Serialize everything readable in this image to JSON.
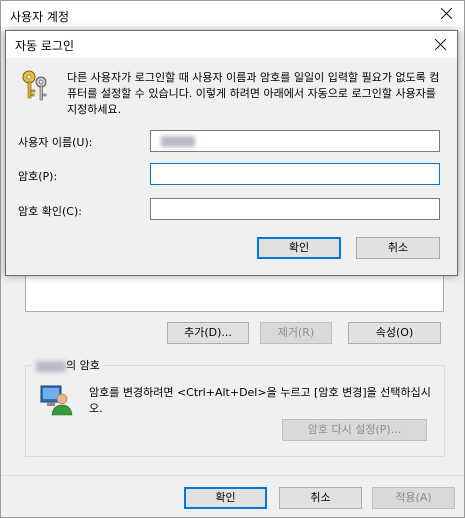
{
  "parent": {
    "title": "사용자 계정",
    "buttons": {
      "add": "추가(D)...",
      "remove": "제거(R)",
      "properties": "속성(O)"
    },
    "password_group": {
      "legend_suffix": "의 암호",
      "text": "암호를 변경하려면 <Ctrl+Alt+Del>을 누르고 [암호 변경]을 선택하십시오.",
      "reset_button": "암호 다시 설정(P)..."
    },
    "footer": {
      "ok": "확인",
      "cancel": "취소",
      "apply": "적용(A)"
    },
    "icons": {
      "close": "close-icon",
      "user": "user-at-computer-icon"
    }
  },
  "dialog": {
    "title": "자동 로그인",
    "description": "다른 사용자가 로그인할 때 사용자 이름과 암호를 일일이 입력할 필요가 없도록 컴퓨터를 설정할 수 있습니다. 이렇게 하려면 아래에서 자동으로 로그인할 사용자를 지정하세요.",
    "fields": {
      "username_label": "사용자 이름(U):",
      "username_value": "",
      "password_label": "암호(P):",
      "password_value": "",
      "confirm_label": "암호 확인(C):",
      "confirm_value": ""
    },
    "buttons": {
      "ok": "확인",
      "cancel": "취소"
    },
    "icons": {
      "close": "close-icon",
      "keys": "keys-icon"
    }
  },
  "colors": {
    "focus_accent": "#0078d7",
    "window_bg": "#f0f0f0"
  }
}
